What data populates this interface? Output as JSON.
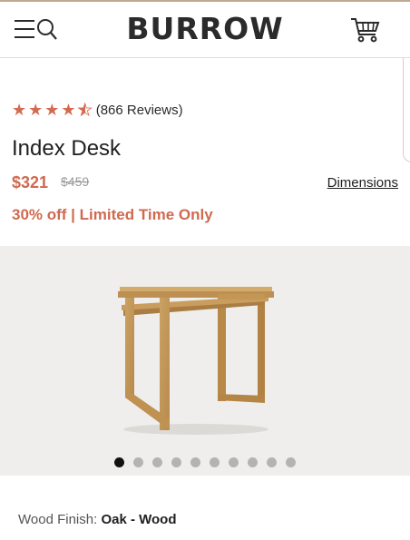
{
  "header": {
    "logo": "BURROW",
    "menu_icon": "hamburger-menu-icon",
    "search_icon": "search-icon",
    "cart_icon": "shopping-cart-icon"
  },
  "product": {
    "rating": 4.5,
    "reviews": "(866 Reviews)",
    "title": "Index Desk",
    "price": "$321",
    "original_price": "$459",
    "dimensions_link": "Dimensions",
    "promo": "30% off | Limited Time Only"
  },
  "gallery": {
    "image": "index-desk-oak",
    "dot_count": 10,
    "active_index": 0
  },
  "options": {
    "finish_label": "Wood Finish:",
    "finish_value": "Oak - Wood"
  },
  "colors": {
    "accent": "#cf6a50",
    "gallery_bg": "#efeeec"
  }
}
